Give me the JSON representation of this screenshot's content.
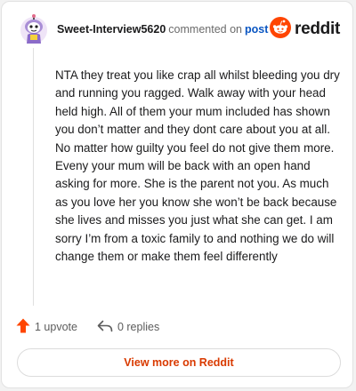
{
  "header": {
    "username": "Sweet-Interview5620",
    "action_text": "commented on",
    "post_link": "post",
    "brand": "reddit",
    "avatar_icon": "snoo-avatar-icon",
    "brand_icon": "reddit-logo-icon"
  },
  "comment": {
    "text": "NTA they treat you like crap all whilst bleeding you dry and running you ragged. Walk away with your head held high. All of them your mum included has shown you don’t matter and they dont care about you at all. No matter how guilty you feel do not give them more. Eveny your mum will be back with an open hand asking for more. She is the parent not you. As much as you love her you know she won’t be back because she lives and misses you just what she can get. I am sorry I’m from a toxic family to and nothing we do will change them or make them feel differently"
  },
  "footer": {
    "upvotes": "1 upvote",
    "replies": "0 replies",
    "upvote_icon": "upvote-arrow-icon",
    "reply_icon": "reply-arrow-icon"
  },
  "view_more": {
    "label": "View more on Reddit"
  },
  "colors": {
    "brand_orange": "#ff4500",
    "upvote": "#ff4500",
    "link_blue": "#0a56c2",
    "button_text": "#d93a00"
  }
}
